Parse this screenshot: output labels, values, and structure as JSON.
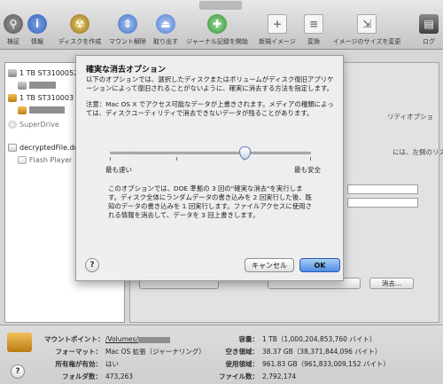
{
  "toolbar": {
    "items": [
      {
        "label": "検証",
        "icon": "microscope-icon",
        "color": "#6b6b6b"
      },
      {
        "label": "情報",
        "icon": "info-icon",
        "color": "#4a78c9"
      },
      {
        "label": "ディスクを作成",
        "icon": "burn-icon",
        "color": "#b58a2c"
      },
      {
        "label": "マウント解除",
        "icon": "unmount-icon",
        "color": "#5d8bd6"
      },
      {
        "label": "取り出す",
        "icon": "eject-icon",
        "color": "#6d93d8"
      },
      {
        "label": "ジャーナル記録を開始",
        "icon": "journal-icon",
        "color": "#3ca83c"
      },
      {
        "label": "新規イメージ",
        "icon": "new-image-icon",
        "color": "#b5b5b5"
      },
      {
        "label": "変換",
        "icon": "convert-icon",
        "color": "#b5b5b5"
      },
      {
        "label": "イメージのサイズを変更",
        "icon": "resize-image-icon",
        "color": "#b5b5b5"
      },
      {
        "label": "ログ",
        "icon": "log-icon",
        "color": "#5a5a5a"
      }
    ]
  },
  "sidebar": {
    "disk1": "1 TB ST3100052",
    "disk2": "1 TB ST310003 3",
    "superdrive": "SuperDrive",
    "file": "decryptedFile.dm",
    "flash": "Flash Player"
  },
  "background": {
    "right_option_text": "リティオプショ",
    "right_hint_text": "には、左側のリス",
    "erase_button": "消去..."
  },
  "sheet": {
    "title": "確実な消去オプション",
    "intro": "以下のオプションでは、選択したディスクまたはボリュームがディスク復旧アプリケーションによって復旧されることがないように、確実に消去する方法を指定します。",
    "note": "注意：Mac OS X でアクセス可能なデータが上書きされます。メディアの種類によっては、ディスクユーティリティで消去できないデータが残ることがあります。",
    "slider_min": "最も速い",
    "slider_max": "最も安全",
    "slider_level_fraction": 0.67,
    "description": "このオプションでは、DOE 準拠の 3 回の\"確実な消去\"を実行します。ディスク全体にランダムデータの書き込みを 2 回実行した後、既知のデータの書き込みを 1 回実行します。ファイルアクセスに使用される情報を消去して、データを 3 回上書きします。",
    "cancel": "キャンセル",
    "ok": "OK"
  },
  "info": {
    "mount_point_label": "マウントポイント：",
    "mount_point_value": "/Volumes/",
    "format_label": "フォーマット：",
    "format_value": "Mac OS 拡張（ジャーナリング）",
    "owners_label": "所有権が有効：",
    "owners_value": "はい",
    "folders_label": "フォルダ数：",
    "folders_value": "473,263",
    "capacity_label": "容量：",
    "capacity_value": "1 TB（1,000,204,853,760 バイト）",
    "available_label": "空き領域：",
    "available_value": "38.37 GB（38,371,844,096 バイト）",
    "used_label": "使用領域：",
    "used_value": "961.83 GB（961,833,009,152 バイト）",
    "files_label": "ファイル数：",
    "files_value": "2,792,174"
  }
}
